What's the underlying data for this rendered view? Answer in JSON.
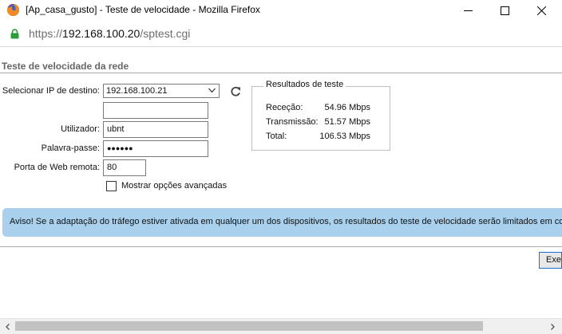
{
  "window": {
    "title": "[Ap_casa_gusto] - Teste de velocidade - Mozilla Firefox"
  },
  "urlbar": {
    "protocol": "https://",
    "host": "192.168.100.20",
    "path": "/sptest.cgi"
  },
  "page": {
    "section_title": "Teste de velocidade da rede",
    "form": {
      "dest_ip_label": "Selecionar IP de destino:",
      "dest_ip_value": "192.168.100.21",
      "extra_ip_value": "",
      "user_label": "Utilizador:",
      "user_value": "ubnt",
      "password_label": "Palavra-passe:",
      "password_value": "●●●●●●",
      "port_label": "Porta de Web remota:",
      "port_value": "80",
      "advanced_label": "Mostrar opções avançadas",
      "advanced_checked": false
    },
    "results": {
      "legend": "Resultados de teste",
      "rows": [
        {
          "label": "Receção:",
          "value": "54.96 Mbps"
        },
        {
          "label": "Transmissão:",
          "value": "51.57 Mbps"
        },
        {
          "label": "Total:",
          "value": "106.53 Mbps"
        }
      ]
    },
    "warning": "Aviso! Se a adaptação do tráfego estiver ativada em qualquer um dos dispositivos, os resultados do teste de velocidade serão limitados em conformidade.",
    "execute_button": "Executar teste"
  },
  "colors": {
    "warning_bg": "#a9d0ec",
    "lock_green": "#2a9d3a",
    "button_border": "#1a6fd0"
  }
}
